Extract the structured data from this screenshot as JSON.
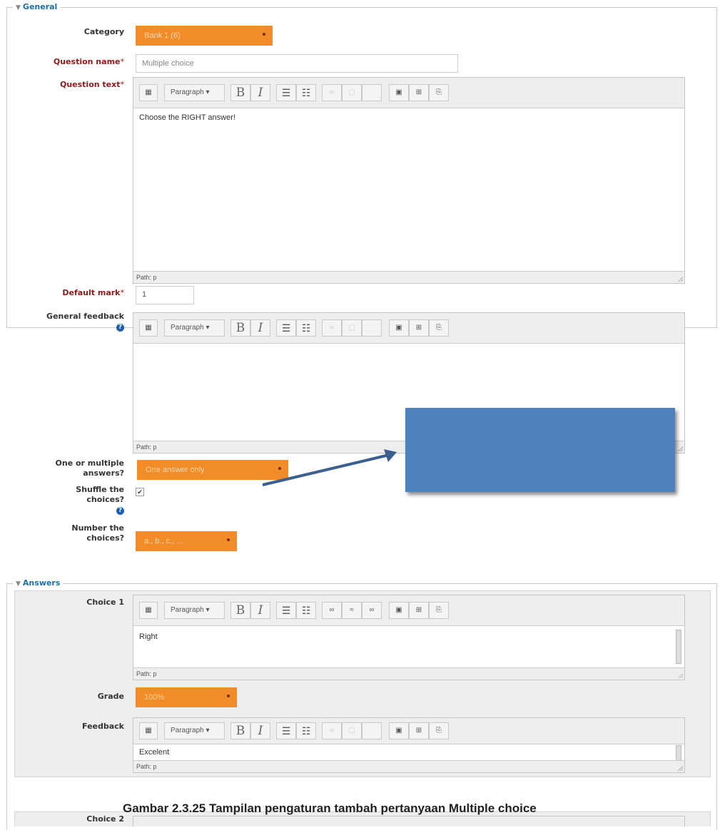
{
  "general": {
    "legend": "General",
    "category_label": "Category",
    "category_value": "Bank 1 (6)",
    "question_name_label": "Question name",
    "question_name_value": "Multiple choice",
    "question_text_label": "Question text",
    "question_text_content": "Choose the RIGHT answer!",
    "default_mark_label": "Default mark",
    "default_mark_value": "1",
    "general_feedback_label": "General feedback",
    "one_or_multiple_label_1": "One or multiple",
    "one_or_multiple_label_2": "answers?",
    "one_or_multiple_value": "One answer only",
    "shuffle_label_1": "Shuffle the",
    "shuffle_label_2": "choices?",
    "number_label_1": "Number the",
    "number_label_2": "choices?",
    "number_value": "a., b., c., ..."
  },
  "editor": {
    "paragraph": "Paragraph",
    "bold": "B",
    "italic": "I",
    "path": "Path: p"
  },
  "answers": {
    "legend": "Answers",
    "choice1_label": "Choice 1",
    "choice1_value": "Right",
    "grade_label": "Grade",
    "grade_value": "100%",
    "feedback_label": "Feedback",
    "feedback_value": "Excelent",
    "choice2_label": "Choice 2"
  },
  "required_star": "*",
  "help_icon_glyph": "?",
  "caption": "Gambar 2.3.25 Tampilan pengaturan tambah pertanyaan Multiple choice",
  "colors": {
    "orange": "#f28c28",
    "callout": "#4f81bd",
    "arrow": "#3b5f8f"
  }
}
